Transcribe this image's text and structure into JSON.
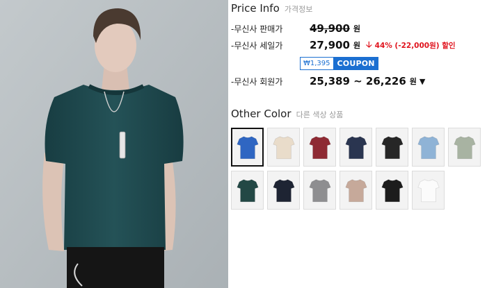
{
  "price_info": {
    "title": "Price Info",
    "title_ko": "가격정보",
    "rows": [
      {
        "label": "-무신사 판매가",
        "value": "49,900",
        "unit": "원"
      },
      {
        "label": "-무신사 세일가",
        "value": "27,900",
        "unit": "원",
        "discount": "44% (-22,000원) 할인"
      },
      {
        "label": "-무신사 회원가",
        "value": "25,389 ~ 26,226",
        "unit": "원"
      }
    ],
    "coupon": {
      "amount": "₩1,395",
      "label": "COUPON"
    }
  },
  "other_color": {
    "title": "Other Color",
    "title_ko": "다른 색상 상품",
    "swatches": [
      {
        "name": "royal blue",
        "color": "#2f66c2"
      },
      {
        "name": "ivory",
        "color": "#e9dcca"
      },
      {
        "name": "burgundy",
        "color": "#8e2a33"
      },
      {
        "name": "navy",
        "color": "#2a3550"
      },
      {
        "name": "black",
        "color": "#262626"
      },
      {
        "name": "sky blue",
        "color": "#8fb3d6"
      },
      {
        "name": "sage",
        "color": "#a8b3a2"
      },
      {
        "name": "dark teal",
        "color": "#234845"
      },
      {
        "name": "dark navy",
        "color": "#1e2433"
      },
      {
        "name": "gray",
        "color": "#8e8e90"
      },
      {
        "name": "pink beige",
        "color": "#c6a99a"
      },
      {
        "name": "charcoal black",
        "color": "#1c1c1c"
      },
      {
        "name": "white",
        "color": "#fbfbfb"
      }
    ]
  },
  "colors": {
    "discount_red": "#e0141e",
    "coupon_blue": "#1b6fd1",
    "product_shirt": "#1f4c52"
  },
  "icons": {
    "discount": "arrow-down-icon",
    "member_price": "caret-down-icon"
  }
}
